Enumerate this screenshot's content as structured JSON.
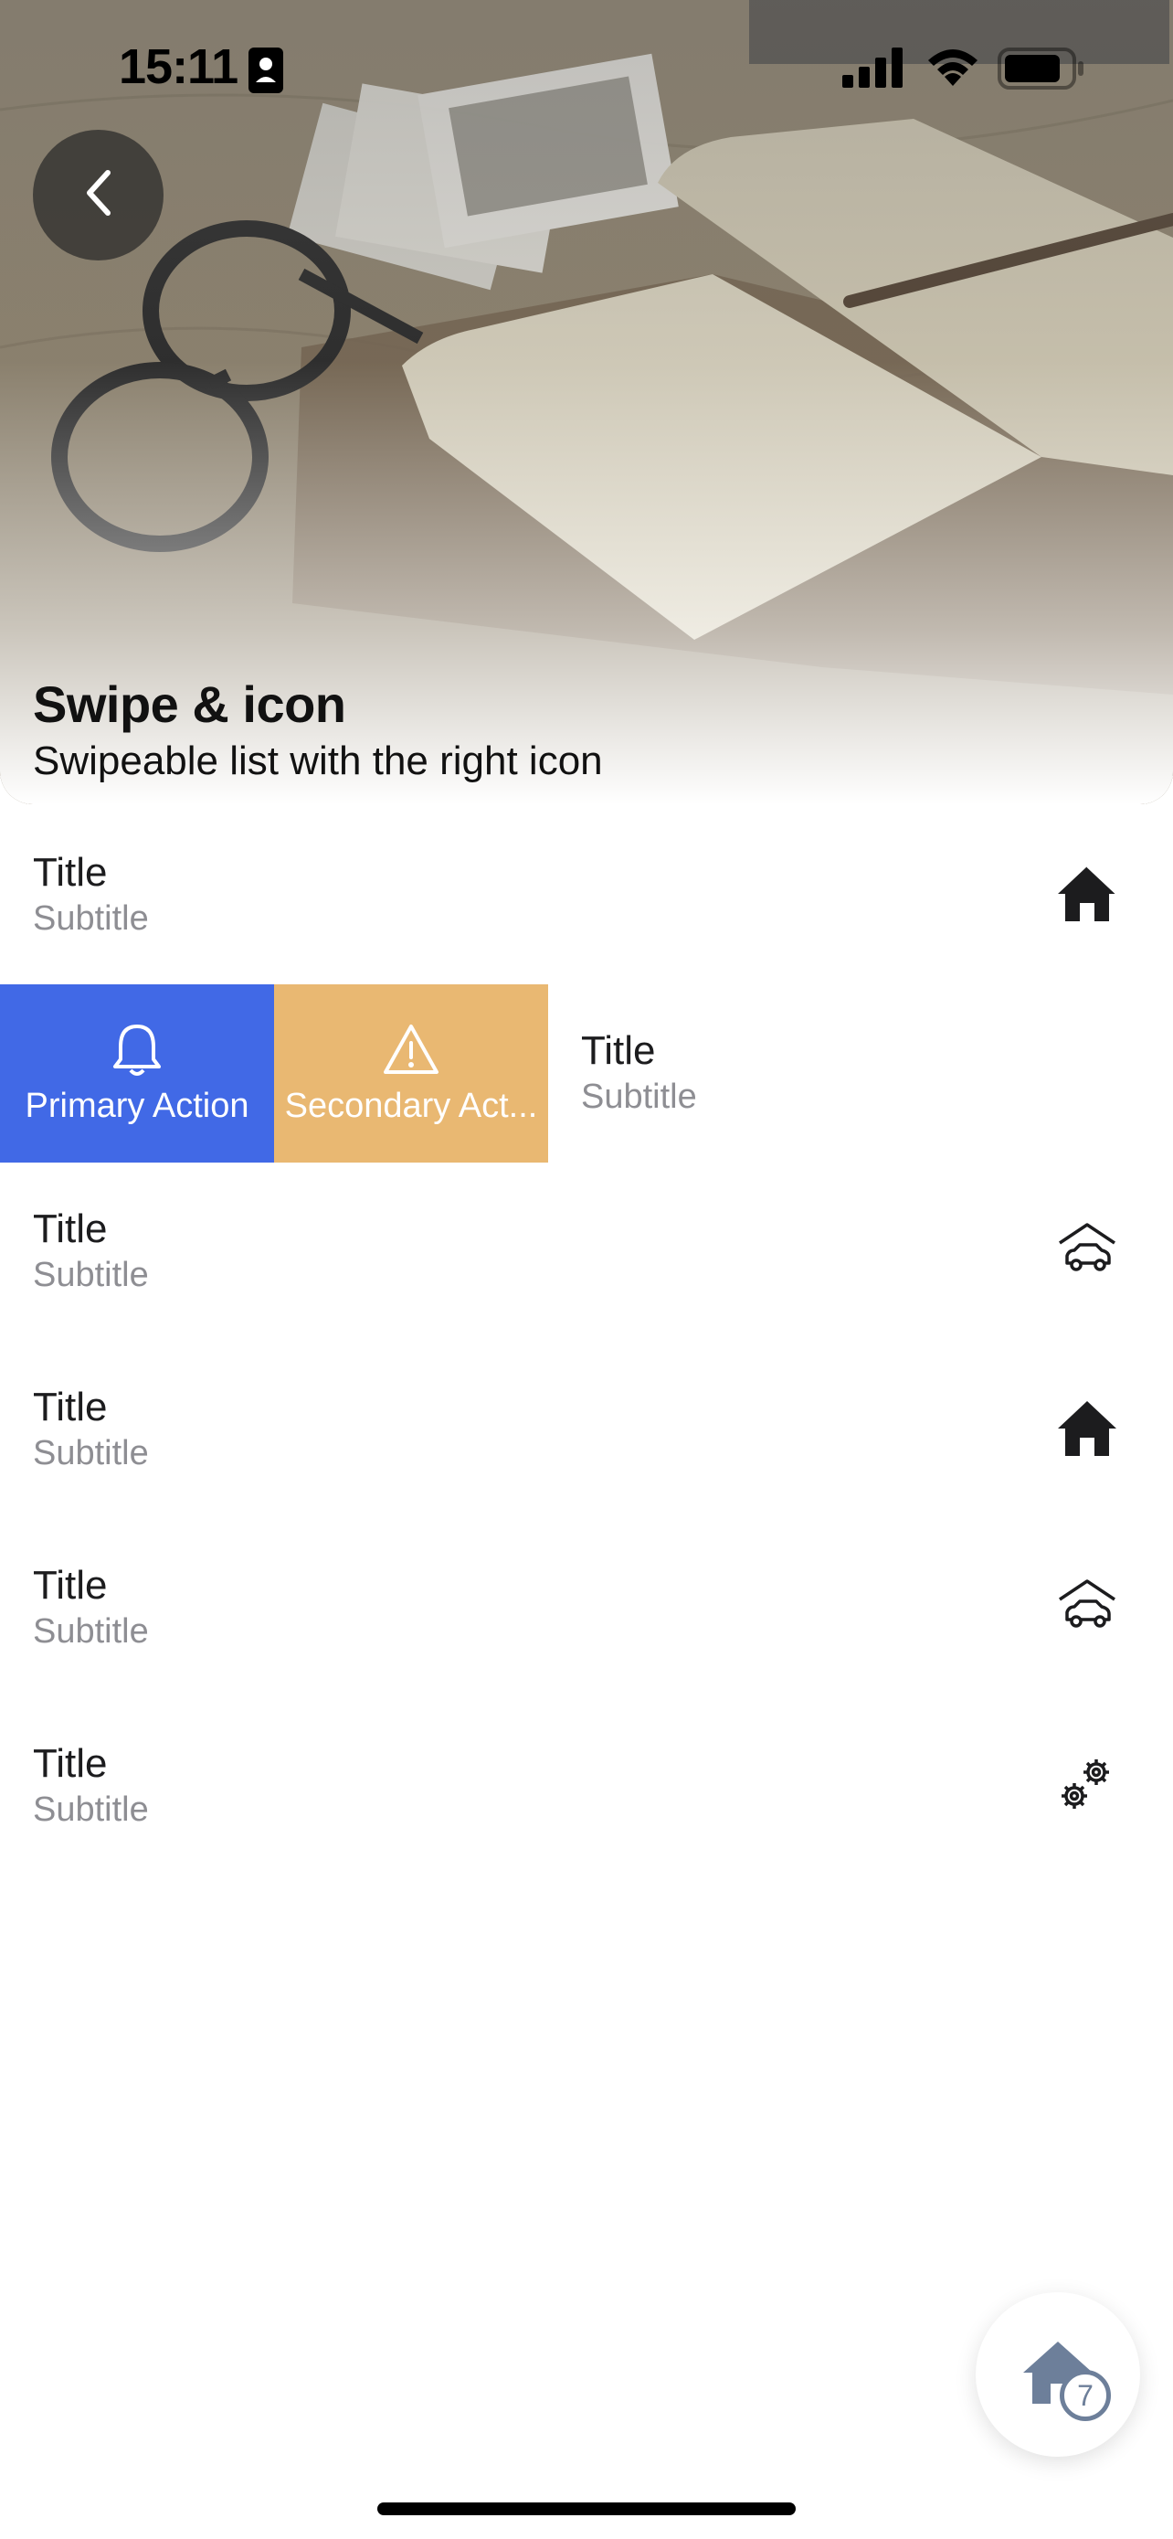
{
  "status_bar": {
    "time": "15:11"
  },
  "header": {
    "title": "Swipe & icon",
    "subtitle": "Swipeable list with the right icon"
  },
  "list": {
    "items": [
      {
        "title": "Title",
        "subtitle": "Subtitle",
        "icon": "house-filled-icon"
      },
      {
        "title": "Title",
        "subtitle": "Subtitle",
        "icon": null
      },
      {
        "title": "Title",
        "subtitle": "Subtitle",
        "icon": "car-garage-icon"
      },
      {
        "title": "Title",
        "subtitle": "Subtitle",
        "icon": "house-filled-icon"
      },
      {
        "title": "Title",
        "subtitle": "Subtitle",
        "icon": "car-garage-icon"
      },
      {
        "title": "Title",
        "subtitle": "Subtitle",
        "icon": "gears-icon"
      }
    ],
    "swipe_actions": {
      "primary": {
        "label": "Primary Action",
        "icon": "bell-icon",
        "color": "#4169e6"
      },
      "secondary": {
        "label": "Secondary Act...",
        "icon": "warning-icon",
        "color": "#e9b872"
      }
    }
  },
  "fab": {
    "icon": "house-icon",
    "badge": "7"
  }
}
